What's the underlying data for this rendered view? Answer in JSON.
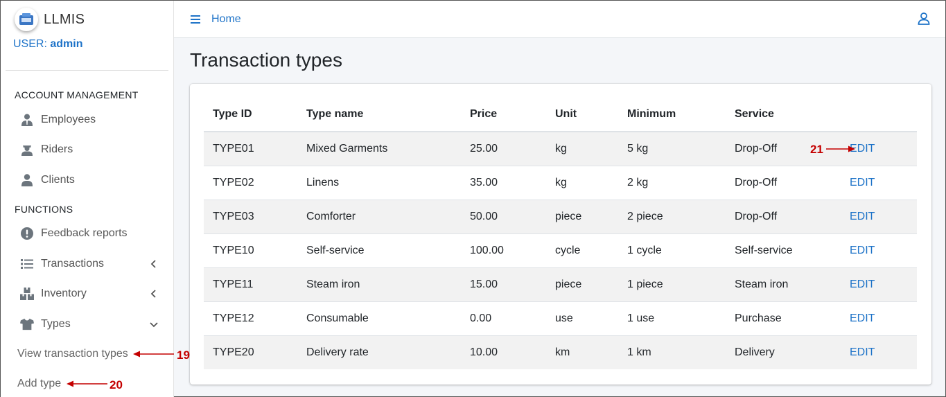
{
  "brand": {
    "name": "LLMIS"
  },
  "user": {
    "label": "USER:",
    "name": "admin"
  },
  "sidebar": {
    "section_account": "ACCOUNT MANAGEMENT",
    "account_items": [
      {
        "label": "Employees",
        "icon": "user-tie-icon"
      },
      {
        "label": "Riders",
        "icon": "rider-icon"
      },
      {
        "label": "Clients",
        "icon": "user-icon"
      }
    ],
    "section_functions": "FUNCTIONS",
    "function_items": [
      {
        "label": "Feedback reports",
        "icon": "exclamation-circle-icon"
      },
      {
        "label": "Transactions",
        "icon": "list-icon"
      },
      {
        "label": "Inventory",
        "icon": "boxes-icon"
      },
      {
        "label": "Types",
        "icon": "tshirt-icon"
      }
    ],
    "sub_items": [
      {
        "label": "View transaction types"
      },
      {
        "label": "Add type"
      }
    ]
  },
  "topbar": {
    "home": "Home"
  },
  "page": {
    "title": "Transaction types"
  },
  "table": {
    "headers": [
      "Type ID",
      "Type name",
      "Price",
      "Unit",
      "Minimum",
      "Service",
      ""
    ],
    "rows": [
      {
        "id": "TYPE01",
        "name": "Mixed Garments",
        "price": "25.00",
        "unit": "kg",
        "minimum": "5 kg",
        "service": "Drop-Off",
        "action": "EDIT"
      },
      {
        "id": "TYPE02",
        "name": "Linens",
        "price": "35.00",
        "unit": "kg",
        "minimum": "2 kg",
        "service": "Drop-Off",
        "action": "EDIT"
      },
      {
        "id": "TYPE03",
        "name": "Comforter",
        "price": "50.00",
        "unit": "piece",
        "minimum": "2 piece",
        "service": "Drop-Off",
        "action": "EDIT"
      },
      {
        "id": "TYPE10",
        "name": "Self-service",
        "price": "100.00",
        "unit": "cycle",
        "minimum": "1 cycle",
        "service": "Self-service",
        "action": "EDIT"
      },
      {
        "id": "TYPE11",
        "name": "Steam iron",
        "price": "15.00",
        "unit": "piece",
        "minimum": "1 piece",
        "service": "Steam iron",
        "action": "EDIT"
      },
      {
        "id": "TYPE12",
        "name": "Consumable",
        "price": "0.00",
        "unit": "use",
        "minimum": "1 use",
        "service": "Purchase",
        "action": "EDIT"
      },
      {
        "id": "TYPE20",
        "name": "Delivery rate",
        "price": "10.00",
        "unit": "km",
        "minimum": "1 km",
        "service": "Delivery",
        "action": "EDIT"
      }
    ]
  },
  "annotations": {
    "a19": "19",
    "a20": "20",
    "a21": "21"
  },
  "colors": {
    "accent": "#1e73c8",
    "annotation": "#c40000"
  }
}
